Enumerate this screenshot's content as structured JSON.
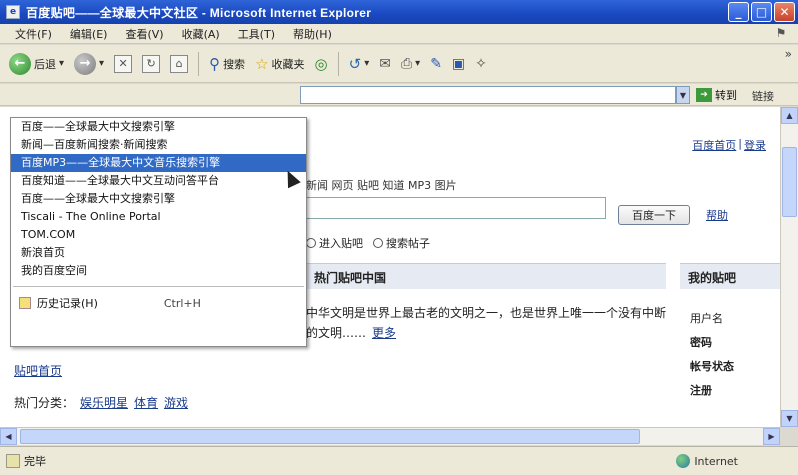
{
  "window": {
    "title": "百度贴吧——全球最大中文社区 - Microsoft Internet Explorer",
    "controls": {
      "minimize": "_",
      "maximize": "□",
      "close": "✕"
    }
  },
  "menubar": {
    "items": [
      "文件(F)",
      "编辑(E)",
      "查看(V)",
      "收藏(A)",
      "工具(T)",
      "帮助(H)"
    ]
  },
  "toolbar": {
    "back_label": "后退",
    "search_label": "搜索",
    "favorites_label": "收藏夹"
  },
  "addressbar": {
    "go_label": "转到",
    "links_label": "链接"
  },
  "history_menu": {
    "items": [
      "百度——全球最大中文搜索引擎",
      "新闻—百度新闻搜索·新闻搜索",
      "百度MP3——全球最大中文音乐搜索引擎",
      "百度知道——全球最大中文互动问答平台",
      "百度——全球最大中文搜索引擎",
      "Tiscali - The Online Portal",
      "TOM.COM",
      "新浪首页",
      "我的百度空间"
    ],
    "selected_index": 2,
    "footer_label": "历史记录(H)",
    "footer_shortcut": "Ctrl+H"
  },
  "page": {
    "top_links": [
      "百度首页",
      "登录"
    ],
    "subtitle": "新闻  网页  贴吧  知道  MP3  图片",
    "search_button": "百度一下",
    "help_link": "帮助",
    "radio_options": [
      "进入贴吧",
      "搜索帖子"
    ],
    "section_title": "热门贴吧中国",
    "side_title": "我的贴吧",
    "paragraph": "中华文明是世界上最古老的文明之一，也是世界上唯一一个没有中断的文明……",
    "paragraph_link": "更多",
    "side_items": [
      "用户名",
      "密码",
      "帐号状态",
      "注册"
    ],
    "left_link": "贴吧首页",
    "left_row_label": "热门分类：",
    "left_row_links": [
      "娱乐明星",
      "体育",
      "游戏"
    ]
  },
  "status": {
    "left_text": "完毕",
    "zone_text": "Internet"
  }
}
